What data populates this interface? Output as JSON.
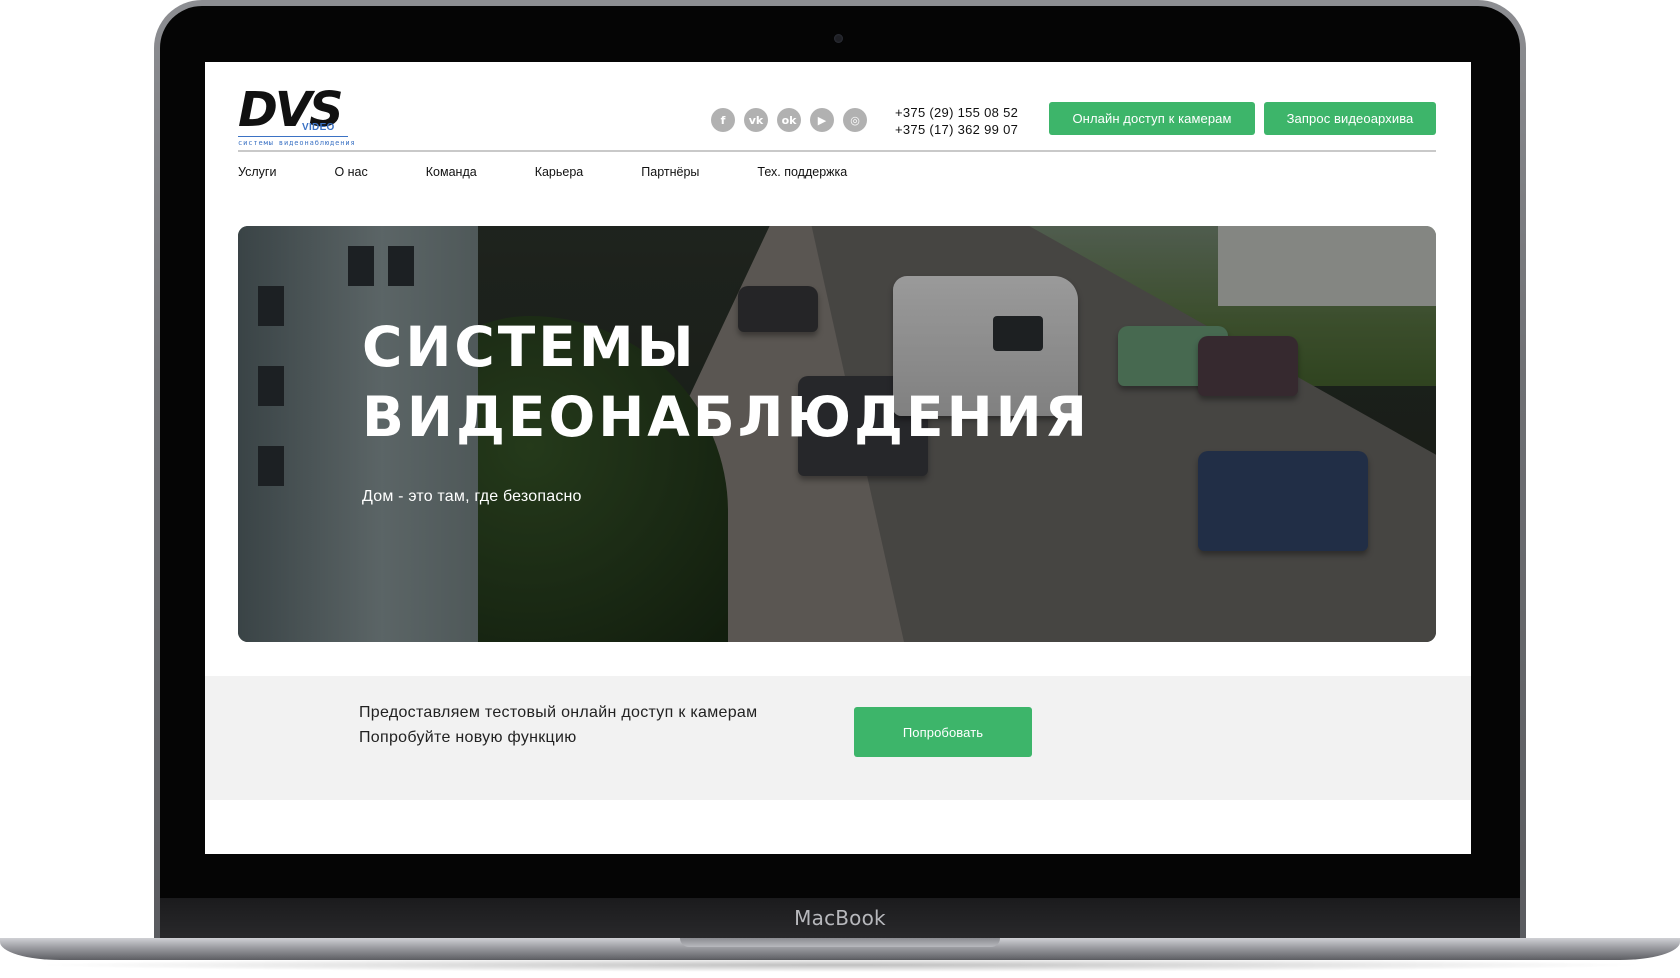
{
  "device": {
    "brand_label": "MacBook"
  },
  "site": {
    "logo": {
      "mark": "DVS",
      "sub": "VIDEO",
      "tagline": "системы видеонаблюдения"
    },
    "social": [
      {
        "name": "facebook-icon",
        "glyph": "f"
      },
      {
        "name": "vk-icon",
        "glyph": "vk"
      },
      {
        "name": "odnoklassniki-icon",
        "glyph": "ok"
      },
      {
        "name": "youtube-icon",
        "glyph": "▶"
      },
      {
        "name": "instagram-icon",
        "glyph": "◎"
      }
    ],
    "phones": [
      "+375 (29) 155 08 52",
      "+375 (17) 362 99 07"
    ],
    "buttons": {
      "online_access": "Онлайн доступ к камерам",
      "archive_request": "Запрос видеоархива"
    },
    "nav": [
      "Услуги",
      "О нас",
      "Команда",
      "Карьера",
      "Партнёры",
      "Тех. поддержка"
    ],
    "hero": {
      "title_line1": "Системы",
      "title_line2": "видеонаблюдения",
      "subtitle": "Дом - это там, где безопасно"
    },
    "promo": {
      "line1": "Предоставляем тестовый онлайн доступ к камерам",
      "line2": "Попробуйте новую функцию",
      "button": "Попробовать"
    }
  },
  "colors": {
    "accent": "#3db56a",
    "social_gray": "#b1b1b1",
    "logo_blue": "#3b72c4"
  }
}
